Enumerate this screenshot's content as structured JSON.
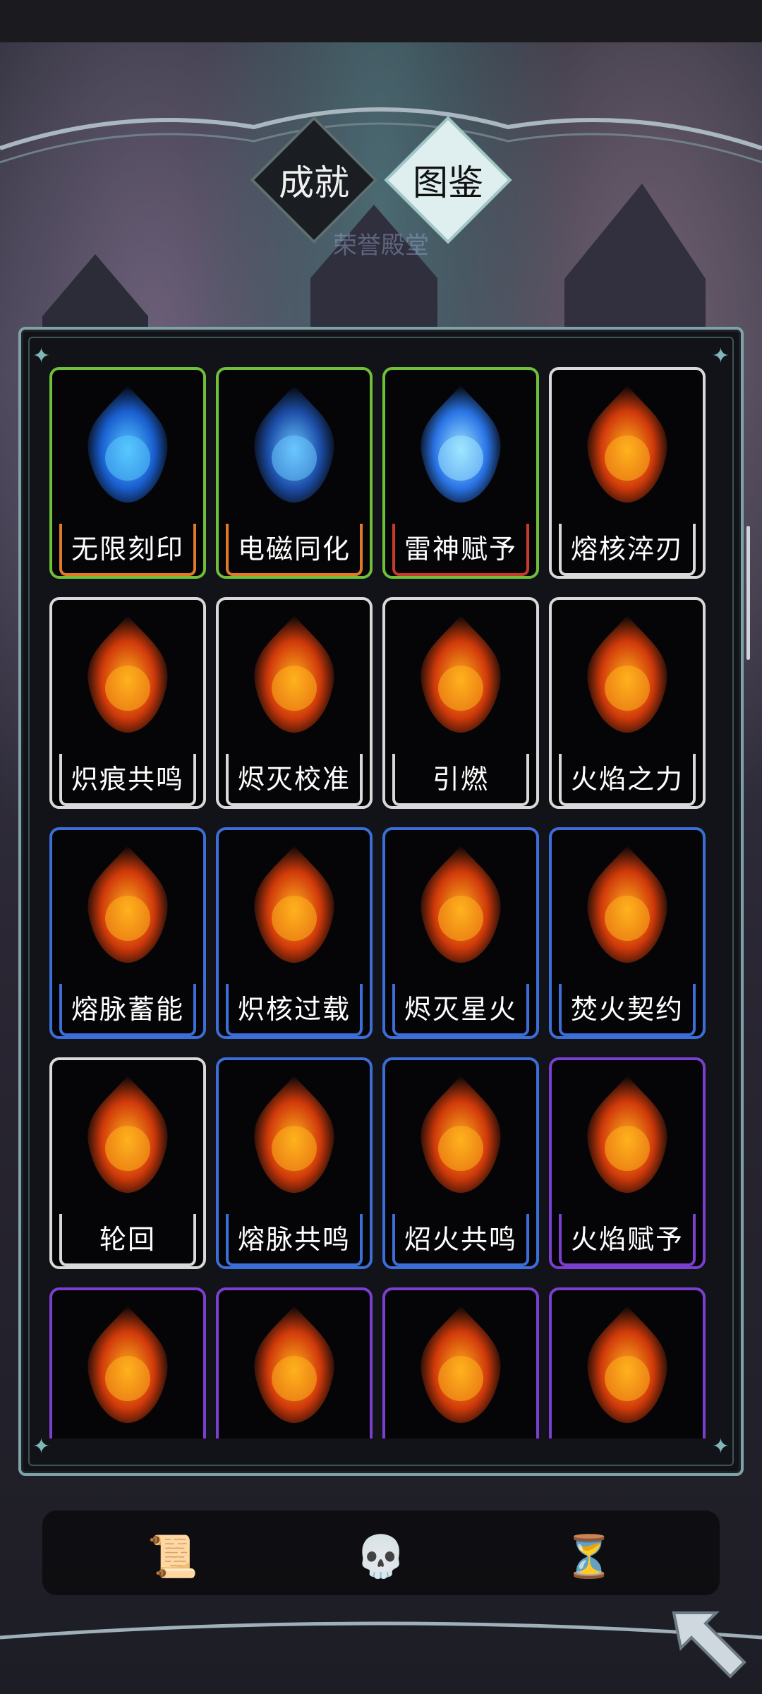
{
  "tabs": {
    "achievements": "成就",
    "codex": "图鉴",
    "hall_title": "荣誉殿堂"
  },
  "cards": [
    {
      "name": "无限刻印",
      "rarity": "green-orange",
      "icon": "blue-rune-coins-icon"
    },
    {
      "name": "电磁同化",
      "rarity": "green-orange",
      "icon": "blue-triskelion-icon"
    },
    {
      "name": "雷神赋予",
      "rarity": "green-red",
      "icon": "blue-flame-orb-icon"
    },
    {
      "name": "熔核淬刃",
      "rarity": "white",
      "icon": "flaming-sword-icon"
    },
    {
      "name": "炽痕共鸣",
      "rarity": "white",
      "icon": "fire-altar-icon"
    },
    {
      "name": "烬灭校准",
      "rarity": "white",
      "icon": "molten-hand-icon"
    },
    {
      "name": "引燃",
      "rarity": "white",
      "icon": "fire-pillar-icon"
    },
    {
      "name": "火焰之力",
      "rarity": "white",
      "icon": "fire-vortex-icon"
    },
    {
      "name": "熔脉蓄能",
      "rarity": "blue",
      "icon": "fire-planet-icon"
    },
    {
      "name": "炽核过载",
      "rarity": "blue",
      "icon": "burning-book-icon"
    },
    {
      "name": "烬灭星火",
      "rarity": "blue",
      "icon": "lava-road-skulls-icon"
    },
    {
      "name": "焚火契约",
      "rarity": "blue",
      "icon": "crossed-arrows-icon"
    },
    {
      "name": "轮回",
      "rarity": "white",
      "icon": "fire-swirl-coins-icon"
    },
    {
      "name": "熔脉共鸣",
      "rarity": "blue",
      "icon": "flaming-shield-icon"
    },
    {
      "name": "炤火共鸣",
      "rarity": "blue",
      "icon": "fire-demon-head-icon"
    },
    {
      "name": "火焰赋予",
      "rarity": "purple",
      "icon": "fire-whip-icon"
    },
    {
      "name": "",
      "rarity": "purple",
      "icon": "fire-orbs-circle-icon"
    },
    {
      "name": "",
      "rarity": "purple",
      "icon": "fire-mask-icon"
    },
    {
      "name": "",
      "rarity": "purple",
      "icon": "rock-hand-fireball-icon"
    },
    {
      "name": "",
      "rarity": "purple",
      "icon": "fire-bull-icon"
    }
  ],
  "nav": {
    "scroll_icon": "scroll-icon",
    "skull_icon": "demon-skull-icon",
    "hourglass_icon": "hourglass-icon",
    "back_icon": "back-arrow-icon"
  },
  "colors": {
    "panel_border": "#7fa2a6",
    "rarity_green": "#6fbf3a",
    "rarity_orange": "#e07a2a",
    "rarity_red": "#c83a2a",
    "rarity_white": "#d9d9d9",
    "rarity_blue": "#3c6ed8",
    "rarity_purple": "#7b3fd0"
  }
}
